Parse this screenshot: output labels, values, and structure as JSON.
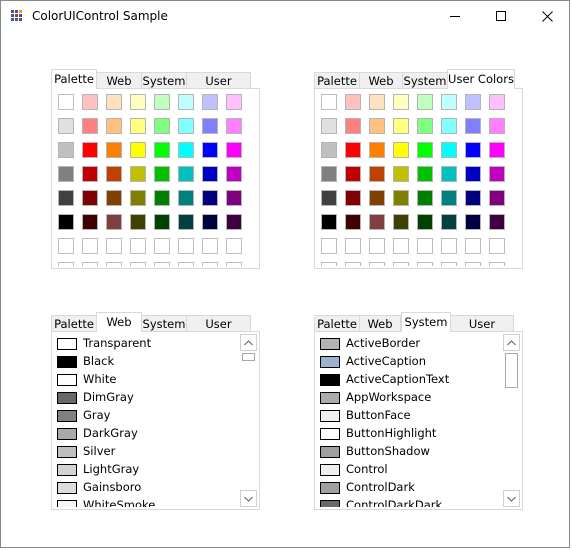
{
  "window": {
    "title": "ColorUIControl Sample"
  },
  "tabs": [
    "Palette",
    "Web",
    "System",
    "User Colors"
  ],
  "palette": {
    "rows": [
      [
        "#ffffff",
        "#ffc0c0",
        "#ffe0c0",
        "#ffffc0",
        "#c0ffc0",
        "#c0ffff",
        "#c0c0ff",
        "#ffc0ff"
      ],
      [
        "#e0e0e0",
        "#ff8080",
        "#ffc080",
        "#ffff80",
        "#80ff80",
        "#80ffff",
        "#8080ff",
        "#ff80ff"
      ],
      [
        "#c0c0c0",
        "#ff0000",
        "#ff8000",
        "#ffff00",
        "#00ff00",
        "#00ffff",
        "#0000ff",
        "#ff00ff"
      ],
      [
        "#808080",
        "#c00000",
        "#c04000",
        "#c0c000",
        "#00c000",
        "#00c0c0",
        "#0000c0",
        "#c000c0"
      ],
      [
        "#404040",
        "#800000",
        "#804000",
        "#808000",
        "#008000",
        "#008080",
        "#000080",
        "#800080"
      ],
      [
        "#000000",
        "#400000",
        "#804040",
        "#404000",
        "#004000",
        "#004040",
        "#000040",
        "#400040"
      ],
      [
        "#ffffff",
        "#ffffff",
        "#ffffff",
        "#ffffff",
        "#ffffff",
        "#ffffff",
        "#ffffff",
        "#ffffff"
      ]
    ]
  },
  "web_colors": [
    {
      "name": "Transparent",
      "color": "#ffffff"
    },
    {
      "name": "Black",
      "color": "#000000"
    },
    {
      "name": "White",
      "color": "#ffffff"
    },
    {
      "name": "DimGray",
      "color": "#696969"
    },
    {
      "name": "Gray",
      "color": "#808080"
    },
    {
      "name": "DarkGray",
      "color": "#a9a9a9"
    },
    {
      "name": "Silver",
      "color": "#c0c0c0"
    },
    {
      "name": "LightGray",
      "color": "#d3d3d3"
    },
    {
      "name": "Gainsboro",
      "color": "#dcdcdc"
    },
    {
      "name": "WhiteSmoke",
      "color": "#f5f5f5"
    }
  ],
  "system_colors": [
    {
      "name": "ActiveBorder",
      "color": "#b4b4b4"
    },
    {
      "name": "ActiveCaption",
      "color": "#99b4d1"
    },
    {
      "name": "ActiveCaptionText",
      "color": "#000000"
    },
    {
      "name": "AppWorkspace",
      "color": "#ababab"
    },
    {
      "name": "ButtonFace",
      "color": "#f0f0f0"
    },
    {
      "name": "ButtonHighlight",
      "color": "#ffffff"
    },
    {
      "name": "ButtonShadow",
      "color": "#a0a0a0"
    },
    {
      "name": "Control",
      "color": "#f0f0f0"
    },
    {
      "name": "ControlDark",
      "color": "#a0a0a0"
    },
    {
      "name": "ControlDarkDark",
      "color": "#696969"
    }
  ],
  "controls": [
    {
      "id": "c1",
      "active_tab": 0,
      "view": "grid",
      "scroll_frac": 0.0
    },
    {
      "id": "c2",
      "active_tab": 3,
      "view": "grid",
      "scroll_frac": 0.0
    },
    {
      "id": "c3",
      "active_tab": 1,
      "view": "web",
      "scroll_frac": 0.0
    },
    {
      "id": "c4",
      "active_tab": 2,
      "view": "system",
      "scroll_frac": 0.0
    }
  ]
}
